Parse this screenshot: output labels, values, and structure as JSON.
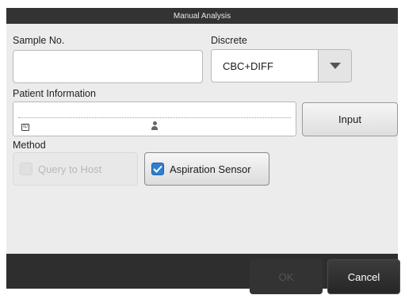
{
  "dialog": {
    "title": "Manual Analysis"
  },
  "form": {
    "sample_no_label": "Sample No.",
    "sample_no_value": "",
    "discrete_label": "Discrete",
    "discrete_value": "CBC+DIFF",
    "patient_info_label": "Patient Information",
    "patient_id_value": "",
    "patient_name_value": "",
    "input_button": "Input",
    "method_label": "Method",
    "query_to_host": {
      "label": "Query to Host",
      "checked": false,
      "enabled": false
    },
    "aspiration_sensor": {
      "label": "Aspiration Sensor",
      "checked": true,
      "enabled": true
    }
  },
  "footer": {
    "ok_label": "OK",
    "cancel_label": "Cancel"
  },
  "icons": {
    "patient_id": "id-card-icon",
    "patient_name": "person-icon",
    "dropdown": "triangle-down-icon",
    "checkmark": "checkmark-icon"
  },
  "colors": {
    "title_bar": "#333333",
    "panel": "#ececec",
    "footer": "#2e2e2e",
    "checkbox_checked": "#2f7fd1"
  }
}
